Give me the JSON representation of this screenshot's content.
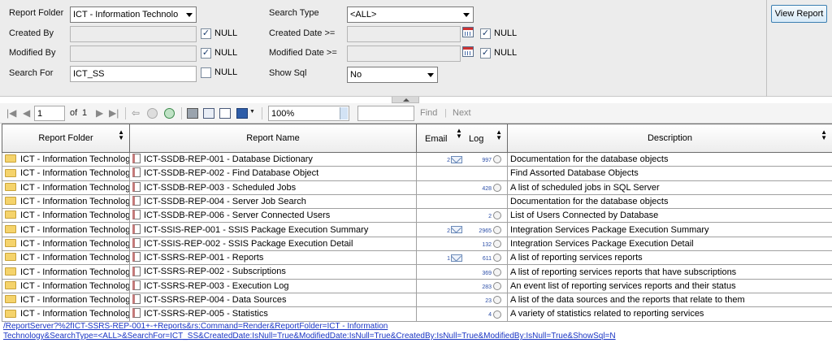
{
  "params": {
    "report_folder": {
      "label": "Report Folder",
      "value": "ICT - Information Technolo"
    },
    "created_by": {
      "label": "Created By",
      "value": "",
      "null_label": "NULL",
      "null_checked": true
    },
    "modified_by": {
      "label": "Modified By",
      "value": "",
      "null_label": "NULL",
      "null_checked": true
    },
    "search_for": {
      "label": "Search For",
      "value": "ICT_SS",
      "null_label": "NULL",
      "null_checked": false
    },
    "search_type": {
      "label": "Search Type",
      "value": "<ALL>"
    },
    "created_date": {
      "label": "Created Date >=",
      "value": "",
      "null_label": "NULL",
      "null_checked": true
    },
    "modified_date": {
      "label": "Modified Date >=",
      "value": "",
      "null_label": "NULL",
      "null_checked": true
    },
    "show_sql": {
      "label": "Show Sql",
      "value": "No"
    },
    "view_report_label": "View Report"
  },
  "toolbar": {
    "page": "1",
    "of_label": "of",
    "total_pages": "1",
    "zoom": "100%",
    "find_label": "Find",
    "next_label": "Next"
  },
  "table": {
    "headers": {
      "folder": "Report Folder",
      "name": "Report Name",
      "email": "Email",
      "log": "Log",
      "description": "Description"
    },
    "rows": [
      {
        "folder": "ICT - Information Technology",
        "name": "ICT-SSDB-REP-001 - Database Dictionary",
        "email": "2",
        "log": "997",
        "description": "Documentation for the database objects"
      },
      {
        "folder": "ICT - Information Technology",
        "name": "ICT-SSDB-REP-002 - Find Database Object",
        "email": "",
        "log": "",
        "description": "Find Assorted Database Objects"
      },
      {
        "folder": "ICT - Information Technology",
        "name": "ICT-SSDB-REP-003 - Scheduled Jobs",
        "email": "",
        "log": "428",
        "description": "A list of scheduled jobs in SQL Server"
      },
      {
        "folder": "ICT - Information Technology",
        "name": "ICT-SSDB-REP-004 - Server Job Search",
        "email": "",
        "log": "",
        "description": "Documentation for the database objects"
      },
      {
        "folder": "ICT - Information Technology",
        "name": "ICT-SSDB-REP-006 - Server Connected Users",
        "email": "",
        "log": "2",
        "description": "List of Users Connected by Database"
      },
      {
        "folder": "ICT - Information Technology",
        "name": "ICT-SSIS-REP-001 - SSIS Package Execution Summary",
        "email": "2",
        "log": "2965",
        "description": "Integration Services Package Execution Summary"
      },
      {
        "folder": "ICT - Information Technology",
        "name": "ICT-SSIS-REP-002 - SSIS Package Execution Detail",
        "email": "",
        "log": "132",
        "description": "Integration Services Package Execution Detail"
      },
      {
        "folder": "ICT - Information Technology",
        "name": "ICT-SSRS-REP-001 - Reports",
        "email": "1",
        "log": "611",
        "description": "A list of reporting services reports"
      },
      {
        "folder": "ICT - Information Technology",
        "name": "ICT-SSRS-REP-002 - Subscriptions",
        "email": "",
        "log": "369",
        "description": "A list of reporting services reports that have subscriptions"
      },
      {
        "folder": "ICT - Information Technology",
        "name": "ICT-SSRS-REP-003 - Execution Log",
        "email": "",
        "log": "283",
        "description": "An event list of reporting services reports and their status"
      },
      {
        "folder": "ICT - Information Technology",
        "name": "ICT-SSRS-REP-004 - Data Sources",
        "email": "",
        "log": "23",
        "description": "A list of the data sources and the reports that relate to them"
      },
      {
        "folder": "ICT - Information Technology",
        "name": "ICT-SSRS-REP-005 - Statistics",
        "email": "",
        "log": "4",
        "description": "A variety of statistics related to reporting services"
      }
    ]
  },
  "url_line1": "/ReportServer?%2fICT-SSRS-REP-001+-+Reports&rs:Command=Render&ReportFolder=ICT - Information",
  "url_line2": "Technology&SearchType=<ALL>&SearchFor=ICT_SS&CreatedDate:IsNull=True&ModifiedDate:IsNull=True&CreatedBy:IsNull=True&ModifiedBy:IsNull=True&ShowSql=N"
}
